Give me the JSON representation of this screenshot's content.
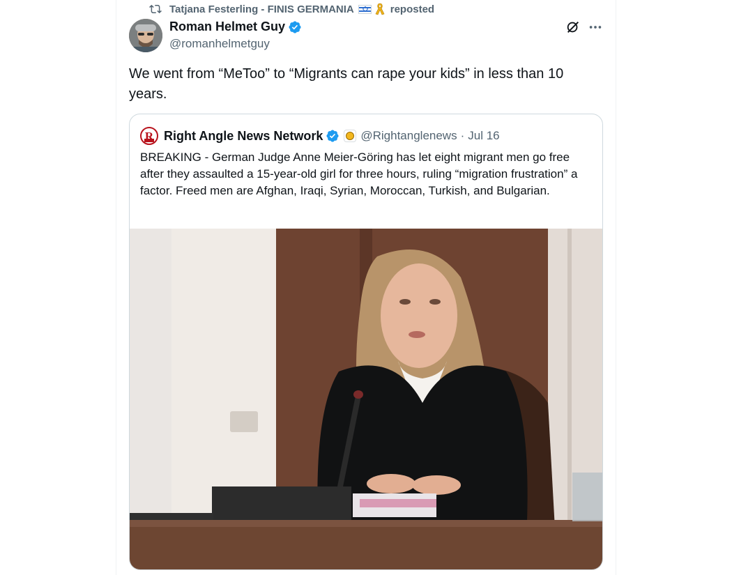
{
  "repost": {
    "reposter": "Tatjana Festerling - FINIS GERMANIA",
    "label": "reposted",
    "icon": "repost-icon"
  },
  "tweet": {
    "author_name": "Roman Helmet Guy",
    "author_handle": "@romanhelmetguy",
    "text": "We went from “MeToo” to “Migrants can rape your kids” in less than 10 years.",
    "verified": true
  },
  "quote": {
    "name": "Right Angle News Network",
    "handle": "@Rightanglenews",
    "separator": "·",
    "date": "Jul 16",
    "text": "BREAKING - German Judge Anne Meier-Göring has let eight migrant men go free after they assaulted a 15-year-old girl for three hours, ruling “migration frustration” a factor. Freed men are Afghan, Iraqi, Syrian, Moroccan, Turkish, and Bulgarian.",
    "logo_letter": "R"
  },
  "colors": {
    "text_primary": "#0f1419",
    "text_secondary": "#536471",
    "verified_blue": "#1d9bf0",
    "border": "#cfd9de",
    "news_red": "#b8121c"
  }
}
